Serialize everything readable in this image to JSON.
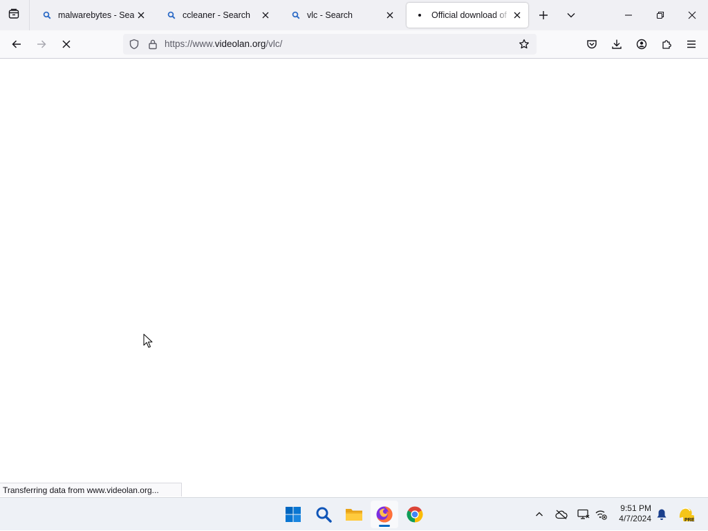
{
  "browser": {
    "tabs": [
      {
        "title": "malwarebytes - Search",
        "favicon": "search-icon",
        "active": false
      },
      {
        "title": "ccleaner - Search",
        "favicon": "search-icon",
        "active": false
      },
      {
        "title": "vlc - Search",
        "favicon": "search-icon",
        "active": false
      },
      {
        "title": "Official download of VLC media player",
        "favicon": "loading-dot-icon",
        "active": true
      }
    ],
    "url": {
      "prefix": "https://www.",
      "host": "videolan.org",
      "path": "/vlc/"
    },
    "status_text": "Transferring data from www.videolan.org...",
    "loading": true
  },
  "taskbar": {
    "apps": [
      "start-icon",
      "search-icon",
      "file-explorer-icon",
      "firefox-icon",
      "chrome-icon"
    ],
    "running_app": "firefox",
    "clock": {
      "time": "9:51 PM",
      "date": "4/7/2024"
    },
    "tray_badge": "PRE"
  },
  "colors": {
    "accent": "#0067c0",
    "tab_strip": "#f0f0f4",
    "toolbar": "#f9f9fb",
    "search_icon_blue": "#2d6bc6"
  }
}
